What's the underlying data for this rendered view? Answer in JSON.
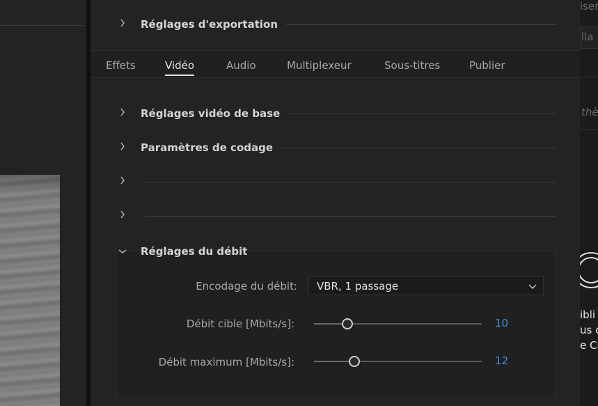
{
  "export_settings": {
    "label": "Réglages d'exportation"
  },
  "tabs": [
    {
      "label": "Effets"
    },
    {
      "label": "Vidéo"
    },
    {
      "label": "Audio"
    },
    {
      "label": "Multiplexeur"
    },
    {
      "label": "Sous-titres"
    },
    {
      "label": "Publier"
    }
  ],
  "active_tab": "Vidéo",
  "sections": {
    "basic_video": "Réglages vidéo de base",
    "encoding": "Paramètres de codage",
    "bitrate": "Réglages du débit"
  },
  "bitrate": {
    "encoding_label": "Encodage du débit:",
    "encoding_value": "VBR, 1 passage",
    "target_label": "Débit cible [Mbits/s]:",
    "target_value": "10",
    "target_fraction": 0.2,
    "max_label": "Débit maximum [Mbits/s]:",
    "max_value": "12",
    "max_fraction": 0.24
  },
  "right_panel": {
    "text1": "iser",
    "text2": "lla",
    "text3": "thè",
    "text4": "ibli",
    "text5": "us c",
    "text6": "e Cr"
  },
  "colors": {
    "accent_blue": "#3d8fe0",
    "background": "#232323"
  }
}
